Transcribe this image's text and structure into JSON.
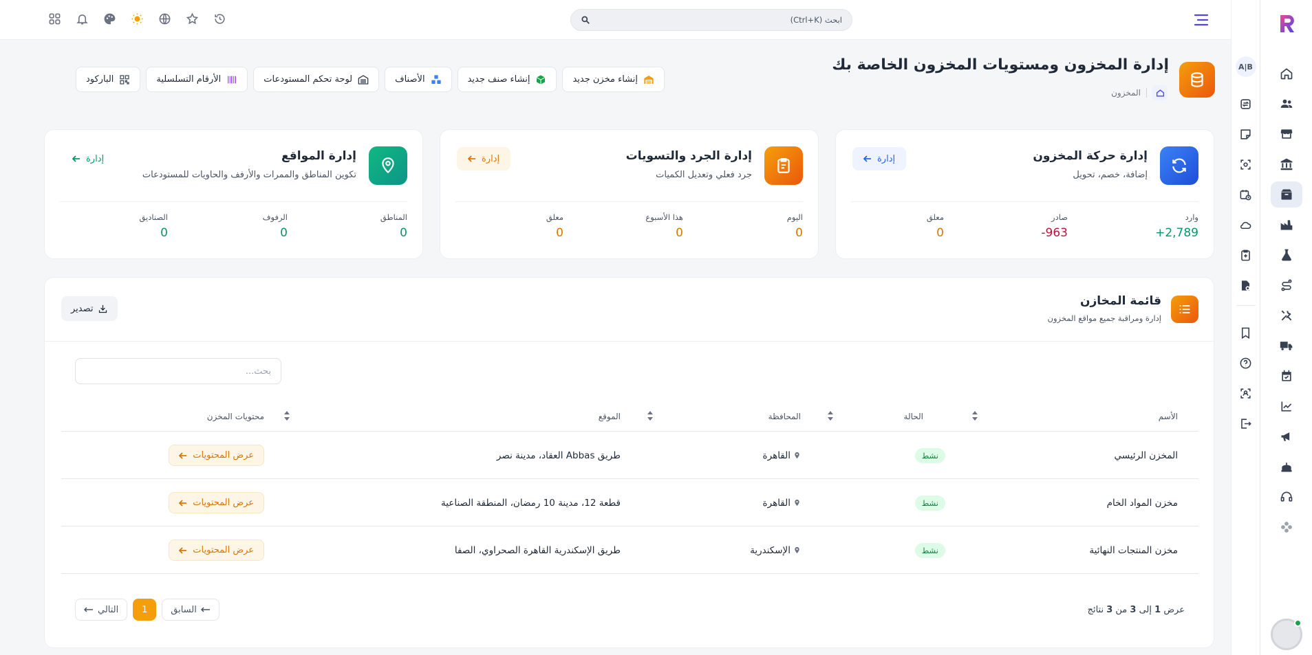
{
  "topbar": {
    "search_placeholder": "ابحث (Ctrl+K)"
  },
  "header": {
    "title": "إدارة المخزون ومستويات المخزون الخاصة بك",
    "breadcrumb": "المخزون"
  },
  "actions": [
    {
      "label": "إنشاء مخزن جديد",
      "icon": "warehouse-icon",
      "color": "#f59e0b"
    },
    {
      "label": "إنشاء صنف جديد",
      "icon": "box-icon",
      "color": "#16a34a"
    },
    {
      "label": "الأصناف",
      "icon": "boxes-icon",
      "color": "#3b82f6"
    },
    {
      "label": "لوحة تحكم المستودعات",
      "icon": "warehouse-dashboard-icon",
      "color": "#374151"
    },
    {
      "label": "الأرقام التسلسلية",
      "icon": "serial-barcode-icon",
      "color": "#a855f7"
    },
    {
      "label": "الباركود",
      "icon": "qrcode-icon",
      "color": "#4b5563"
    }
  ],
  "cards": {
    "movement": {
      "title": "إدارة حركة المخزون",
      "subtitle": "إضافة، خصم، تحويل",
      "manage": "إدارة",
      "color": "#2563eb",
      "stats": [
        {
          "label": "وارد",
          "value": "+2,789",
          "color": "#059669"
        },
        {
          "label": "صادر",
          "value": "-963",
          "color": "#be123c"
        },
        {
          "label": "معلق",
          "value": "0",
          "color": "#d97706"
        }
      ]
    },
    "stocktake": {
      "title": "إدارة الجرد والتسويات",
      "subtitle": "جرد فعلي وتعديل الكميات",
      "manage": "إدارة",
      "color": "#f59e0b",
      "stats": [
        {
          "label": "اليوم",
          "value": "0",
          "color": "#d97706"
        },
        {
          "label": "هذا الأسبوع",
          "value": "0",
          "color": "#d97706"
        },
        {
          "label": "معلق",
          "value": "0",
          "color": "#d97706"
        }
      ]
    },
    "locations": {
      "title": "إدارة المواقع",
      "subtitle": "تكوين المناطق والممرات والأرفف والحاويات للمستودعات",
      "manage": "إدارة",
      "color": "#10b981",
      "stats": [
        {
          "label": "المناطق",
          "value": "0",
          "color": "#059669"
        },
        {
          "label": "الرفوف",
          "value": "0",
          "color": "#059669"
        },
        {
          "label": "الصناديق",
          "value": "0",
          "color": "#059669"
        }
      ]
    }
  },
  "list": {
    "title": "قائمة المخازن",
    "subtitle": "إدارة ومراقبة جميع مواقع المخزون",
    "export": "تصدير",
    "search_placeholder": "بحث...",
    "columns": [
      "الأسم",
      "الحالة",
      "المحافظة",
      "الموقع",
      "محتويات المخزن"
    ],
    "rows": [
      {
        "name": "المخزن الرئيسي",
        "status": "نشط",
        "gov": "القاهرة",
        "location": "طريق Abbas العقاد، مدينة نصر",
        "action": "عرض المحتويات"
      },
      {
        "name": "مخزن المواد الخام",
        "status": "نشط",
        "gov": "القاهرة",
        "location": "قطعة 12، مدينة 10 رمضان، المنطقة الصناعية",
        "action": "عرض المحتويات"
      },
      {
        "name": "مخزن المنتجات النهائية",
        "status": "نشط",
        "gov": "الإسكندرية",
        "location": "طريق الإسكندرية القاهرة الصحراوي، الصفا",
        "action": "عرض المحتويات"
      }
    ],
    "pagination": {
      "info_prefix": "عرض",
      "from": "1",
      "to_word": "إلى",
      "to": "3",
      "of_word": "من",
      "total": "3",
      "suffix": "نتائج",
      "prev": "السابق",
      "current": "1",
      "next": "التالي"
    }
  },
  "colors": {
    "accent": "#f59e0b",
    "brand": "#4f46e5",
    "active_status": "#15803d"
  }
}
